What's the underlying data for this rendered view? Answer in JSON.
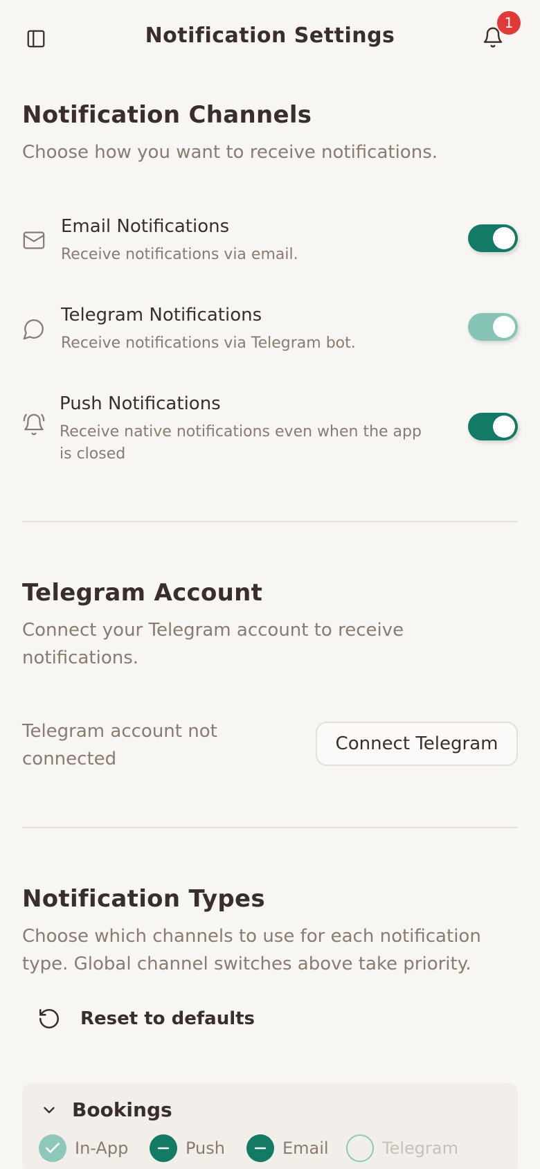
{
  "header": {
    "title": "Notification Settings",
    "notification_count": "1"
  },
  "channels": {
    "title": "Notification Channels",
    "description": "Choose how you want to receive notifications.",
    "items": [
      {
        "title": "Email Notifications",
        "description": "Receive notifications via email.",
        "icon": "mail-icon",
        "enabled": true
      },
      {
        "title": "Telegram Notifications",
        "description": "Receive notifications via Telegram bot.",
        "icon": "message-circle-icon",
        "enabled": true,
        "dimmed": true
      },
      {
        "title": "Push Notifications",
        "description": "Receive native notifications even when the app is closed",
        "icon": "bell-ring-icon",
        "enabled": true
      }
    ]
  },
  "telegram": {
    "title": "Telegram Account",
    "description": "Connect your Telegram account to receive notifications.",
    "status": "Telegram account not connected",
    "connect_label": "Connect Telegram"
  },
  "types": {
    "title": "Notification Types",
    "description": "Choose which channels to use for each notification type. Global channel switches above take priority.",
    "reset_label": "Reset to defaults",
    "groups": [
      {
        "title": "Bookings",
        "options": [
          {
            "label": "In-App",
            "state": "checked"
          },
          {
            "label": "Push",
            "state": "indeterminate"
          },
          {
            "label": "Email",
            "state": "indeterminate"
          },
          {
            "label": "Telegram",
            "state": "unchecked-disabled"
          }
        ]
      }
    ]
  },
  "colors": {
    "accent": "#137a63",
    "accent_light": "#86c4b6",
    "badge": "#e13a36",
    "background": "#f8f6f3"
  }
}
